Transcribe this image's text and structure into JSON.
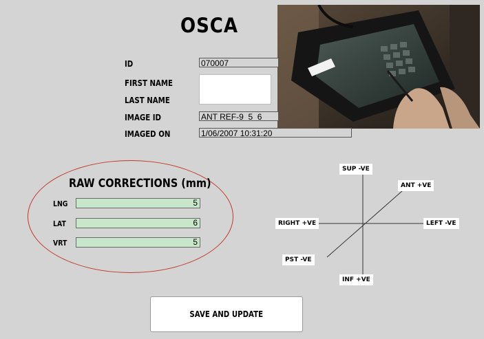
{
  "app": {
    "title": "OSCA"
  },
  "patient": {
    "id_label": "ID",
    "id_value": "070007",
    "first_name_label": "FIRST NAME",
    "first_name_value": "",
    "last_name_label": "LAST NAME",
    "last_name_value": "",
    "image_id_label": "IMAGE ID",
    "image_id_value": "ANT REF-9_5_6",
    "imaged_on_label": "IMAGED ON",
    "imaged_on_value": "1/06/2007 10:31:20"
  },
  "corrections": {
    "title": "RAW CORRECTIONS (mm)",
    "rows": [
      {
        "label": "LNG",
        "value": "5"
      },
      {
        "label": "LAT",
        "value": "6"
      },
      {
        "label": "VRT",
        "value": "5"
      }
    ]
  },
  "directions": {
    "sup": "SUP -VE",
    "ant": "ANT +VE",
    "right": "RIGHT +VE",
    "left": "LEFT -VE",
    "pst": "PST -VE",
    "inf": "INF +VE"
  },
  "actions": {
    "save_label": "SAVE AND UPDATE"
  },
  "colors": {
    "background": "#d4d4d4",
    "ellipse": "#c0392b",
    "field_green": "#c8e6c9"
  }
}
